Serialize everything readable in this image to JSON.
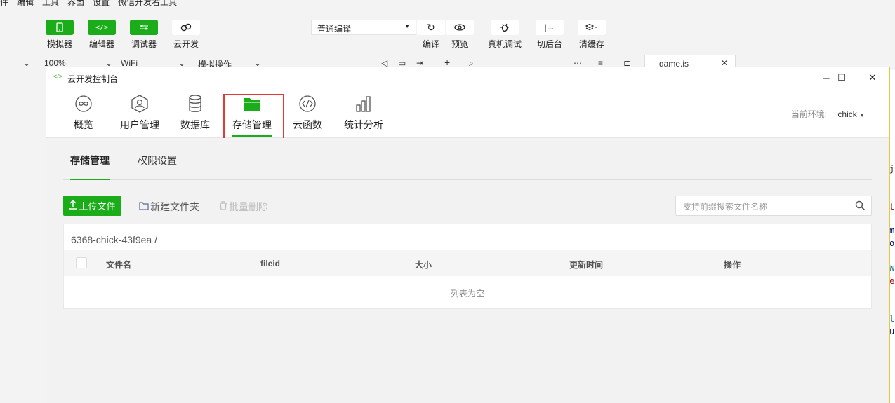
{
  "menubar": [
    "件",
    "编辑",
    "工具",
    "界面",
    "设置",
    "微信开发者工具"
  ],
  "toolbar": {
    "simulator": "模拟器",
    "editor": "编辑器",
    "debugger": "调试器",
    "cloud": "云开发",
    "compile_mode": "普通编译",
    "compile": "编译",
    "preview": "预览",
    "real_debug": "真机调试",
    "background": "切后台",
    "clear_cache": "清缓存"
  },
  "subbar": {
    "zoom": "100%",
    "network": "WiFi",
    "simulate_op": "模拟操作",
    "file_tab": "game.js"
  },
  "dialog": {
    "title": "云开发控制台",
    "nav": [
      {
        "label": "概览"
      },
      {
        "label": "用户管理"
      },
      {
        "label": "数据库"
      },
      {
        "label": "存储管理"
      },
      {
        "label": "云函数"
      },
      {
        "label": "统计分析"
      }
    ],
    "env_label": "当前环境:",
    "env_value": "chick",
    "subtabs": [
      "存储管理",
      "权限设置"
    ],
    "upload_btn": "上传文件",
    "new_folder_btn": "新建文件夹",
    "batch_delete_btn": "批量删除",
    "search_placeholder": "支持前缀搜索文件名称",
    "path": "6368-chick-43f9ea  /",
    "columns": [
      "文件名",
      "fileid",
      "大小",
      "更新时间",
      "操作"
    ],
    "empty_text": "列表为空"
  },
  "code_peek": [
    "j",
    "t",
    "m",
    "o",
    "W",
    "e",
    "l",
    "u"
  ],
  "colors": {
    "accent": "#1aad19",
    "highlight": "#e53935"
  }
}
